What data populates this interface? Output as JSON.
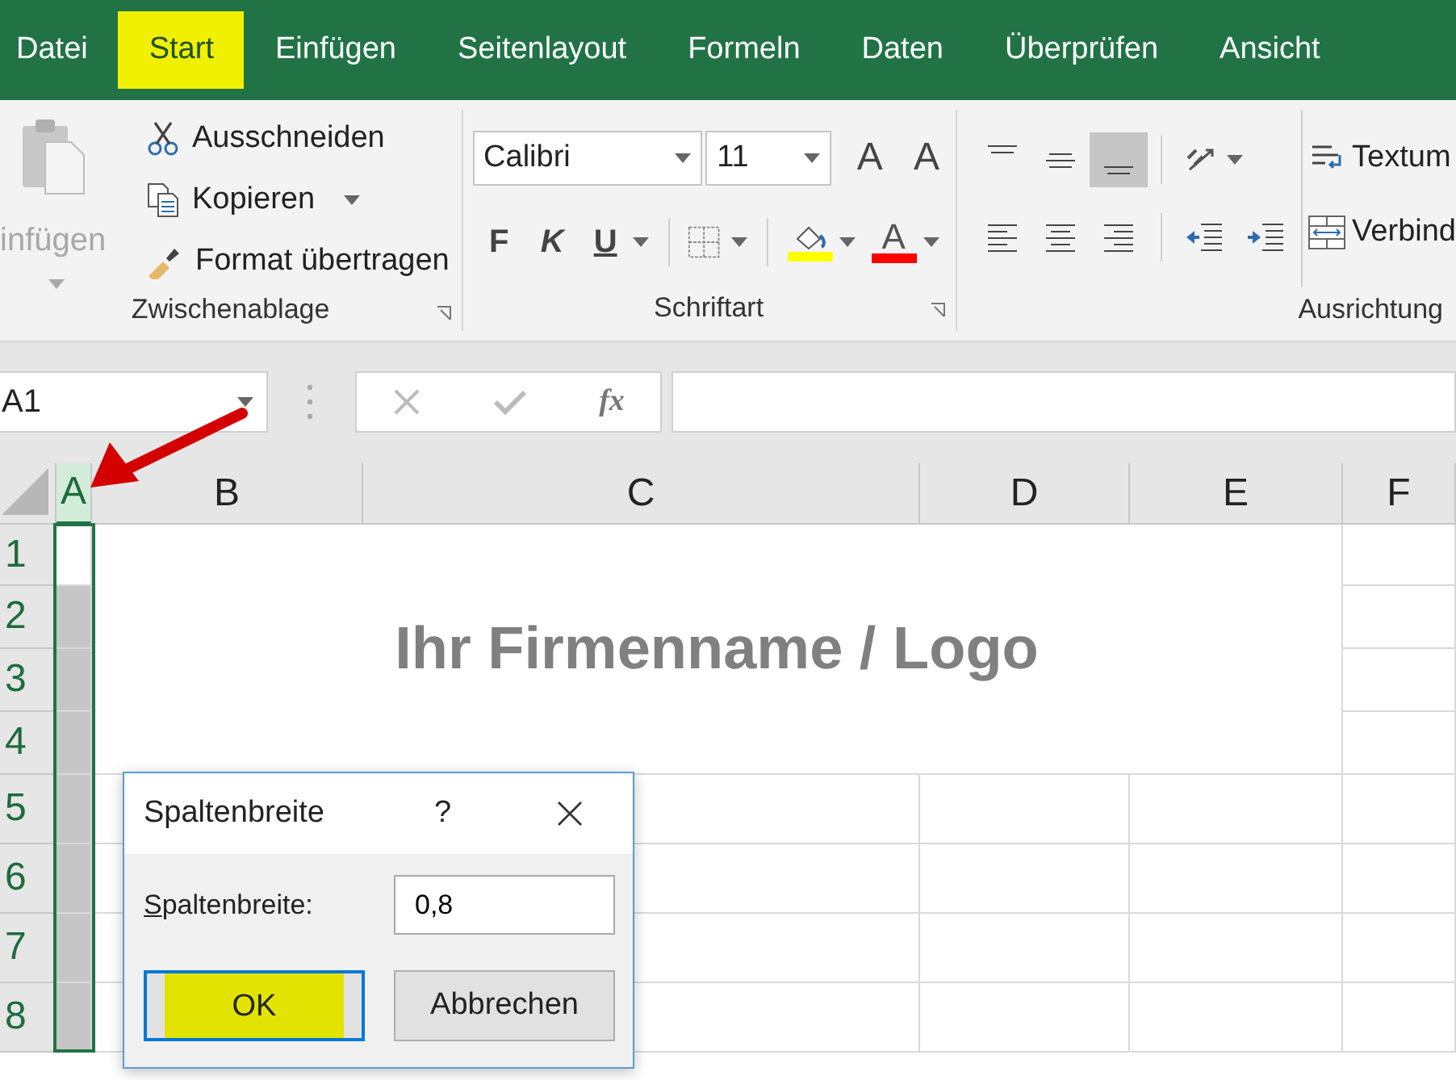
{
  "tabs": [
    {
      "label": "Datei",
      "selected": false
    },
    {
      "label": "Start",
      "selected": true
    },
    {
      "label": "Einfügen",
      "selected": false
    },
    {
      "label": "Seitenlayout",
      "selected": false
    },
    {
      "label": "Formeln",
      "selected": false
    },
    {
      "label": "Daten",
      "selected": false
    },
    {
      "label": "Überprüfen",
      "selected": false
    },
    {
      "label": "Ansicht",
      "selected": false
    }
  ],
  "ribbon": {
    "clipboard": {
      "paste": {
        "label": "infügen",
        "disabled": true
      },
      "commands": [
        {
          "label": "Ausschneiden",
          "kind": "cut",
          "dropdown": false
        },
        {
          "label": "Kopieren",
          "kind": "copy",
          "dropdown": true
        },
        {
          "label": "Format übertragen",
          "kind": "painter",
          "dropdown": false
        }
      ],
      "group_label": "Zwischenablage"
    },
    "font": {
      "font_name": "Calibri",
      "font_size": "11",
      "grow_glyph": "A",
      "shrink_glyph": "A",
      "style_buttons": [
        {
          "glyph": "F",
          "kind": "bold",
          "dropdown": false
        },
        {
          "glyph": "K",
          "kind": "italic",
          "dropdown": false
        },
        {
          "glyph": "U",
          "kind": "underline",
          "dropdown": true
        }
      ],
      "font_color_glyph": "A",
      "group_label": "Schriftart"
    },
    "alignment": {
      "vertical": [
        {
          "kind": "top",
          "selected": false
        },
        {
          "kind": "middle",
          "selected": false
        },
        {
          "kind": "bottom",
          "selected": true
        }
      ],
      "horizontal": [
        {
          "kind": "left",
          "selected": false
        },
        {
          "kind": "center",
          "selected": false
        },
        {
          "kind": "right",
          "selected": false
        }
      ],
      "wrap_text": "Textum",
      "merge": "Verbind",
      "group_label": "Ausrichtung"
    }
  },
  "formula_bar": {
    "name_box": "A1",
    "function_button": "fx"
  },
  "sheet": {
    "columns": [
      {
        "label": "A",
        "selected": true
      },
      {
        "label": "B",
        "selected": false
      },
      {
        "label": "C",
        "selected": false
      },
      {
        "label": "D",
        "selected": false
      },
      {
        "label": "E",
        "selected": false
      },
      {
        "label": "F",
        "selected": false
      }
    ],
    "rows": [
      "1",
      "2",
      "3",
      "4",
      "5",
      "6",
      "7",
      "8"
    ],
    "merged_title": "Ihr Firmenname / Logo"
  },
  "dialog": {
    "title": "Spaltenbreite",
    "help": "?",
    "label": {
      "text": "Spaltenbreite:",
      "mnemonic_underlined": true
    },
    "value": "0,8",
    "buttons": [
      {
        "label": "OK",
        "default": true,
        "highlighted": true
      },
      {
        "label": "Abbrechen",
        "default": false,
        "highlighted": false
      }
    ]
  }
}
